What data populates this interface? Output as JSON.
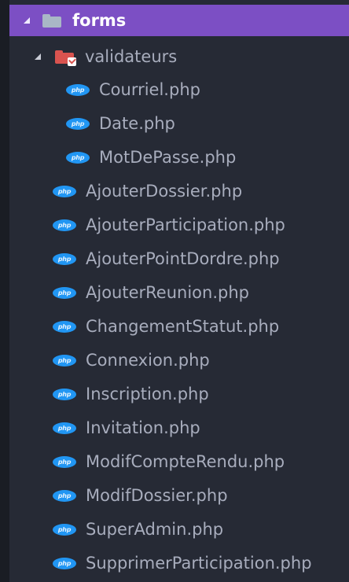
{
  "tree": {
    "root_folder": {
      "label": "forms",
      "expanded": true,
      "icon": "folder-open-icon",
      "selected": true
    },
    "subfolder": {
      "label": "validateurs",
      "expanded": true,
      "icon": "folder-red-check-icon"
    },
    "subfolder_files": [
      {
        "label": "Courriel.php",
        "icon": "php-file-icon"
      },
      {
        "label": "Date.php",
        "icon": "php-file-icon"
      },
      {
        "label": "MotDePasse.php",
        "icon": "php-file-icon"
      }
    ],
    "files": [
      {
        "label": "AjouterDossier.php",
        "icon": "php-file-icon"
      },
      {
        "label": "AjouterParticipation.php",
        "icon": "php-file-icon"
      },
      {
        "label": "AjouterPointDordre.php",
        "icon": "php-file-icon"
      },
      {
        "label": "AjouterReunion.php",
        "icon": "php-file-icon"
      },
      {
        "label": "ChangementStatut.php",
        "icon": "php-file-icon"
      },
      {
        "label": "Connexion.php",
        "icon": "php-file-icon"
      },
      {
        "label": "Inscription.php",
        "icon": "php-file-icon"
      },
      {
        "label": "Invitation.php",
        "icon": "php-file-icon"
      },
      {
        "label": "ModifCompteRendu.php",
        "icon": "php-file-icon"
      },
      {
        "label": "ModifDossier.php",
        "icon": "php-file-icon"
      },
      {
        "label": "SuperAdmin.php",
        "icon": "php-file-icon"
      },
      {
        "label": "SupprimerParticipation.php",
        "icon": "php-file-icon"
      }
    ],
    "php_icon_text": "php"
  },
  "colors": {
    "background": "#262a35",
    "selected_row": "#7c4fc4",
    "text": "#a8adbd",
    "php_icon": "#2196f3",
    "folder_red": "#d9534f"
  }
}
